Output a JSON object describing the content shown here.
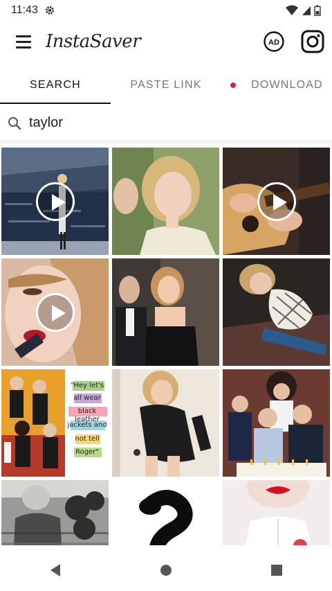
{
  "status_bar": {
    "time": "11:43"
  },
  "app_bar": {
    "title": "InstaSaver",
    "ad_badge": "AD"
  },
  "tabs": [
    {
      "label": "SEARCH",
      "active": true
    },
    {
      "label": "PASTE LINK",
      "active": false
    },
    {
      "label": "DOWNLOAD",
      "active": false,
      "has_dot": true,
      "dot_color": "#d81b60"
    }
  ],
  "search": {
    "query": "taylor"
  },
  "grid": {
    "items": [
      {
        "kind": "video",
        "desc": "stadium-performance"
      },
      {
        "kind": "photo",
        "desc": "blonde-portrait"
      },
      {
        "kind": "video",
        "desc": "guitar-closeup"
      },
      {
        "kind": "video",
        "desc": "singing-closeup"
      },
      {
        "kind": "photo",
        "desc": "black-dress-event"
      },
      {
        "kind": "photo",
        "desc": "lace-top-sitting"
      },
      {
        "kind": "photo",
        "desc": "band-meme",
        "quote_lines": [
          "\"Hey let's",
          "all wear",
          "black leather",
          "jackets and",
          "not tell",
          "Roger\""
        ]
      },
      {
        "kind": "photo",
        "desc": "black-bodysuit"
      },
      {
        "kind": "photo",
        "desc": "group-cake"
      },
      {
        "kind": "photo",
        "desc": "vintage-bw"
      },
      {
        "kind": "photo",
        "desc": "snake-graphic"
      },
      {
        "kind": "photo",
        "desc": "red-lips"
      }
    ]
  },
  "nav": {
    "icons": [
      "back-icon",
      "home-icon",
      "recents-icon"
    ]
  }
}
